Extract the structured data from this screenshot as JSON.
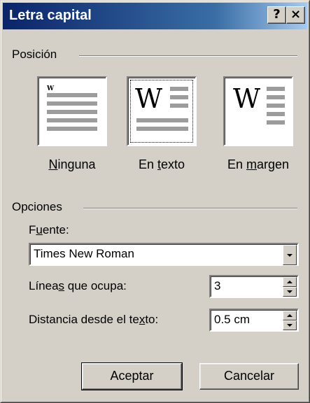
{
  "dialog": {
    "title": "Letra capital",
    "help_button": "?",
    "close_button": "×"
  },
  "position_group": {
    "label": "Posición",
    "options": [
      {
        "label_pre": "",
        "mnemonic": "N",
        "label_post": "inguna",
        "preview_letter": "W",
        "selected": false
      },
      {
        "label_pre": "En ",
        "mnemonic": "t",
        "label_post": "exto",
        "preview_letter": "W",
        "selected": true
      },
      {
        "label_pre": "En ",
        "mnemonic": "m",
        "label_post": "argen",
        "preview_letter": "W",
        "selected": false
      }
    ]
  },
  "options_group": {
    "label": "Opciones",
    "font": {
      "label_pre": "F",
      "mnemonic": "u",
      "label_post": "ente:",
      "value": "Times New Roman"
    },
    "lines": {
      "label_pre": "Línea",
      "mnemonic": "s",
      "label_post": " que ocupa:",
      "value": "3"
    },
    "distance": {
      "label_pre": "Distancia desde el te",
      "mnemonic": "x",
      "label_post": "to:",
      "value": "0.5 cm"
    }
  },
  "buttons": {
    "ok": "Aceptar",
    "cancel": "Cancelar"
  },
  "colors": {
    "face": "#d4d0c8",
    "title_start": "#0a246a",
    "title_end": "#a6caf0"
  }
}
